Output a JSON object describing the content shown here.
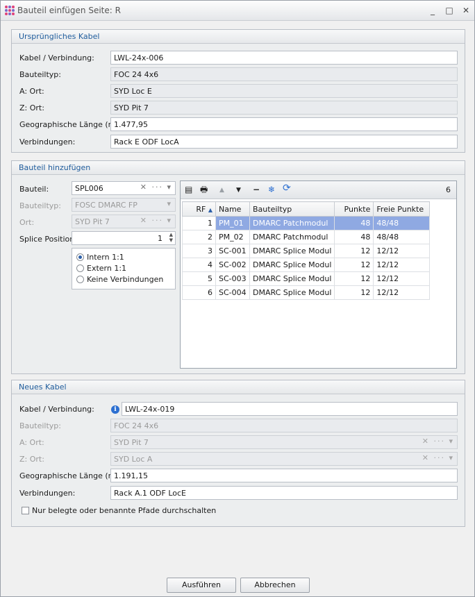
{
  "window": {
    "title": "Bauteil einfügen Seite: R",
    "minimize_glyph": "_",
    "maximize_glyph": "□",
    "close_glyph": "✕"
  },
  "original_cable": {
    "header": "Ursprüngliches Kabel",
    "cable_label": "Kabel / Verbindung:",
    "cable_value": "LWL-24x-006",
    "type_label": "Bauteiltyp:",
    "type_value": "FOC 24 4x6",
    "a_label": "A: Ort:",
    "a_value": "SYD Loc E",
    "z_label": "Z: Ort:",
    "z_value": "SYD Pit 7",
    "length_label": "Geographische Länge (m):",
    "length_value": "1.477,95",
    "connections_label": "Verbindungen:",
    "connections_value": "Rack E ODF LocA"
  },
  "add_component": {
    "header": "Bauteil hinzufügen",
    "component_label": "Bauteil:",
    "component_value": "SPL006",
    "type_label": "Bauteiltyp:",
    "type_value": "FOSC DMARC FP",
    "location_label": "Ort:",
    "location_value": "SYD Pit 7",
    "splice_label": "Splice Position:",
    "splice_value": "1",
    "clear_glyph": "✕",
    "more_glyph": "···",
    "dropdown_glyph": "▾",
    "radio_options": [
      "Intern 1:1",
      "Extern 1:1",
      "Keine Verbindungen"
    ],
    "selected_radio": "Intern 1:1",
    "grid": {
      "count": "6",
      "sort_glyph": "▲",
      "toolbar_glyphs": {
        "columns": "▤",
        "print": "🖶",
        "up": "▲",
        "down": "▼",
        "remove": "−",
        "freeze": "❄",
        "refresh": "⟳"
      },
      "columns": [
        "RF",
        "Name",
        "Bauteiltyp",
        "Punkte",
        "Freie Punkte"
      ],
      "rows": [
        {
          "rf": "1",
          "name": "PM_01",
          "type": "DMARC Patchmodul",
          "points": "48",
          "free": "48/48"
        },
        {
          "rf": "2",
          "name": "PM_02",
          "type": "DMARC Patchmodul",
          "points": "48",
          "free": "48/48"
        },
        {
          "rf": "3",
          "name": "SC-001",
          "type": "DMARC Splice Modul",
          "points": "12",
          "free": "12/12"
        },
        {
          "rf": "4",
          "name": "SC-002",
          "type": "DMARC Splice Modul",
          "points": "12",
          "free": "12/12"
        },
        {
          "rf": "5",
          "name": "SC-003",
          "type": "DMARC Splice Modul",
          "points": "12",
          "free": "12/12"
        },
        {
          "rf": "6",
          "name": "SC-004",
          "type": "DMARC Splice Modul",
          "points": "12",
          "free": "12/12"
        }
      ],
      "selected_row": 0
    }
  },
  "new_cable": {
    "header": "Neues Kabel",
    "cable_label": "Kabel / Verbindung:",
    "cable_value": "LWL-24x-019",
    "info_glyph": "i",
    "type_label": "Bauteiltyp:",
    "type_value": "FOC 24 4x6",
    "a_label": "A: Ort:",
    "a_value": "SYD Pit 7",
    "z_label": "Z: Ort:",
    "z_value": "SYD Loc A",
    "length_label": "Geographische Länge (m):",
    "length_value": "1.191,15",
    "connections_label": "Verbindungen:",
    "connections_value": "Rack A.1 ODF LocE",
    "checkbox_label": "Nur belegte oder benannte Pfade durchschalten",
    "checkbox_checked": false
  },
  "footer": {
    "execute_label": "Ausführen",
    "cancel_label": "Abbrechen"
  },
  "colors": {
    "header_text": "#1f5c9c",
    "selection": "#8fa9e2",
    "accent": "#2c5fa8"
  }
}
